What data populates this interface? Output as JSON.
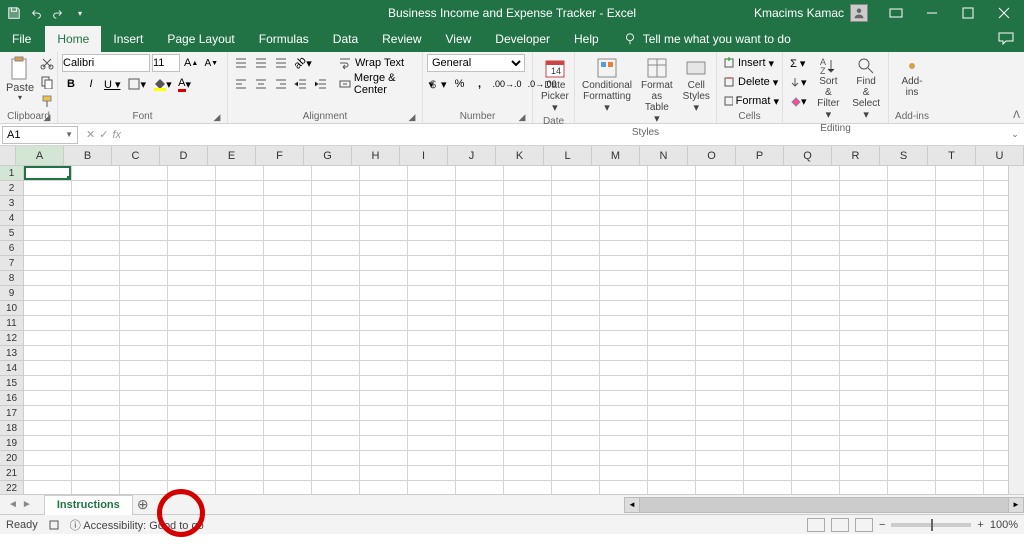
{
  "titlebar": {
    "title": "Business Income and Expense Tracker  -  Excel",
    "user": "Kmacims Kamac"
  },
  "tabs": {
    "file": "File",
    "home": "Home",
    "insert": "Insert",
    "page_layout": "Page Layout",
    "formulas": "Formulas",
    "data": "Data",
    "review": "Review",
    "view": "View",
    "developer": "Developer",
    "help": "Help",
    "tell_me": "Tell me what you want to do"
  },
  "ribbon": {
    "clipboard": {
      "label": "Clipboard",
      "paste": "Paste"
    },
    "font": {
      "label": "Font",
      "name": "Calibri",
      "size": "11"
    },
    "alignment": {
      "label": "Alignment",
      "wrap": "Wrap Text",
      "merge": "Merge & Center"
    },
    "number": {
      "label": "Number",
      "format": "General"
    },
    "date": {
      "label": "Date",
      "picker": "Date Picker"
    },
    "styles": {
      "label": "Styles",
      "cond": "Conditional Formatting",
      "table": "Format as Table",
      "cell": "Cell Styles"
    },
    "cells": {
      "label": "Cells",
      "insert": "Insert",
      "delete": "Delete",
      "format": "Format"
    },
    "editing": {
      "label": "Editing",
      "sort": "Sort & Filter",
      "find": "Find & Select"
    },
    "addins": {
      "label": "Add-ins",
      "btn": "Add-ins"
    }
  },
  "namebox": "A1",
  "columns": [
    "A",
    "B",
    "C",
    "D",
    "E",
    "F",
    "G",
    "H",
    "I",
    "J",
    "K",
    "L",
    "M",
    "N",
    "O",
    "P",
    "Q",
    "R",
    "S",
    "T",
    "U"
  ],
  "rows": [
    "1",
    "2",
    "3",
    "4",
    "5",
    "6",
    "7",
    "8",
    "9",
    "10",
    "11",
    "12",
    "13",
    "14",
    "15",
    "16",
    "17",
    "18",
    "19",
    "20",
    "21",
    "22"
  ],
  "sheet_tab": "Instructions",
  "status": {
    "ready": "Ready",
    "accessibility": "Accessibility: Good to go",
    "zoom": "100%"
  }
}
